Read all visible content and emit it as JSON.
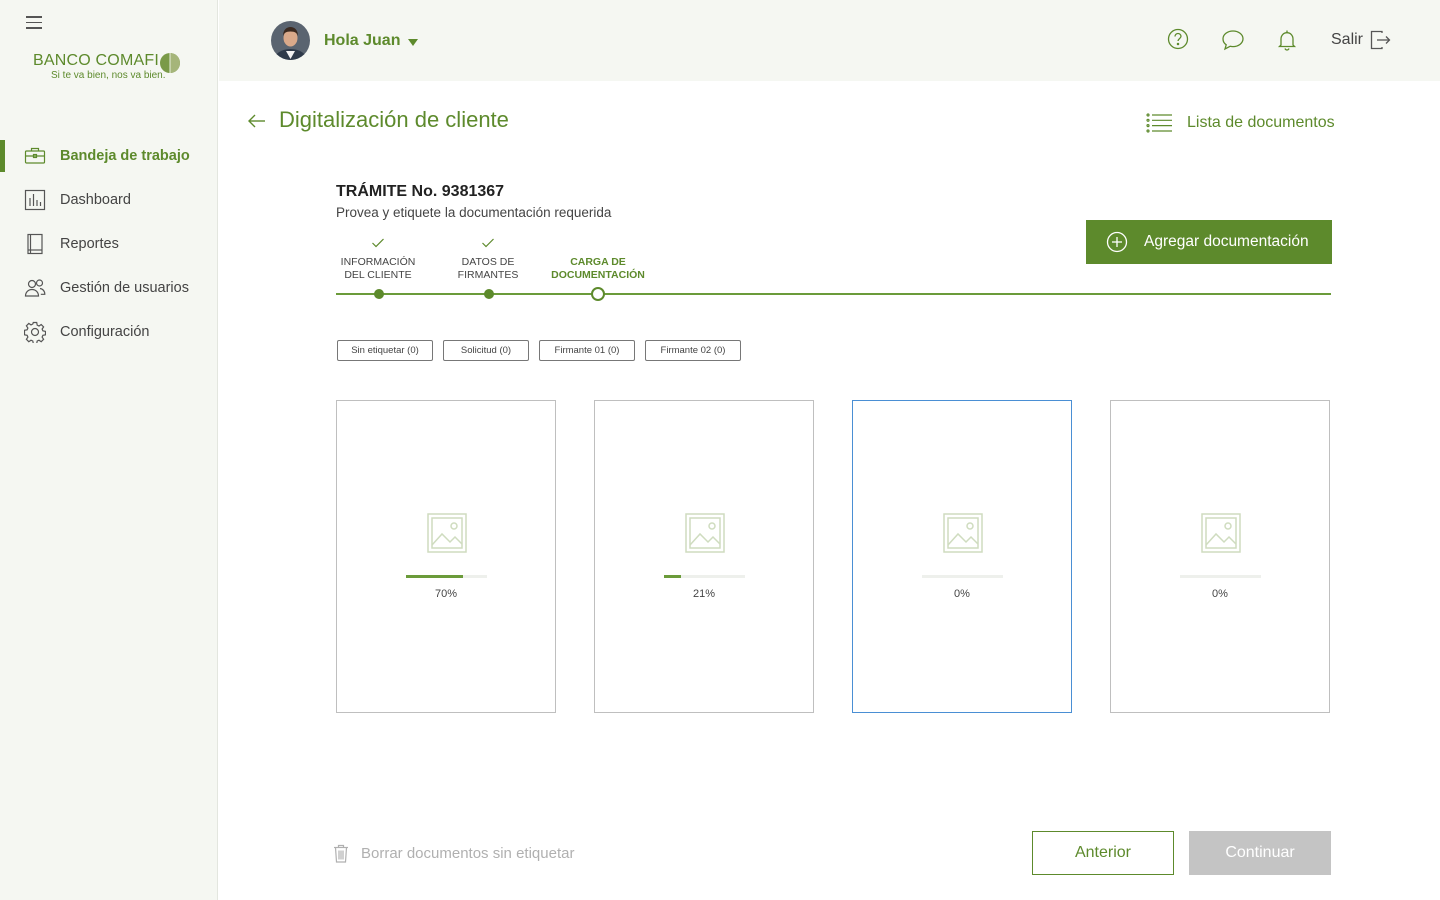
{
  "colors": {
    "brand": "#5d8a2c",
    "sidebar_bg": "#f5f7f2",
    "selected_border": "#4a8fd4",
    "disabled": "#c4c4c4"
  },
  "brand": {
    "name": "BANCO COMAFI",
    "slogan": "Si te va bien, nos va bien."
  },
  "sidebar": {
    "items": [
      {
        "label": "Bandeja de trabajo",
        "icon": "briefcase-icon",
        "active": true
      },
      {
        "label": "Dashboard",
        "icon": "bar-chart-icon",
        "active": false
      },
      {
        "label": "Reportes",
        "icon": "book-icon",
        "active": false
      },
      {
        "label": "Gestión de usuarios",
        "icon": "users-icon",
        "active": false
      },
      {
        "label": "Configuración",
        "icon": "gear-icon",
        "active": false
      }
    ]
  },
  "header": {
    "greeting": "Hola Juan",
    "icons": [
      "help-icon",
      "chat-icon",
      "bell-icon"
    ],
    "logout_label": "Salir"
  },
  "page": {
    "title": "Digitalización de cliente",
    "doc_list_label": "Lista de documentos"
  },
  "tramite": {
    "title": "TRÁMITE No. 9381367",
    "subtitle": "Provea y etiquete la documentación requerida",
    "add_button": "Agregar documentación"
  },
  "stepper": [
    {
      "line1": "INFORMACIÓN",
      "line2": "DEL CLIENTE",
      "status": "done"
    },
    {
      "line1": "DATOS DE",
      "line2": "FIRMANTES",
      "status": "done"
    },
    {
      "line1": "CARGA DE",
      "line2": "DOCUMENTACIÓN",
      "status": "current"
    }
  ],
  "tags": [
    "Sin etiquetar (0)",
    "Solicitud (0)",
    "Firmante 01 (0)",
    "Firmante 02 (0)"
  ],
  "cards": [
    {
      "progress": 70,
      "label": "70%",
      "selected": false
    },
    {
      "progress": 21,
      "label": "21%",
      "selected": false
    },
    {
      "progress": 0,
      "label": "0%",
      "selected": true
    },
    {
      "progress": 0,
      "label": "0%",
      "selected": false
    }
  ],
  "footer": {
    "delete_label": "Borrar documentos sin etiquetar",
    "prev_label": "Anterior",
    "next_label": "Continuar"
  }
}
